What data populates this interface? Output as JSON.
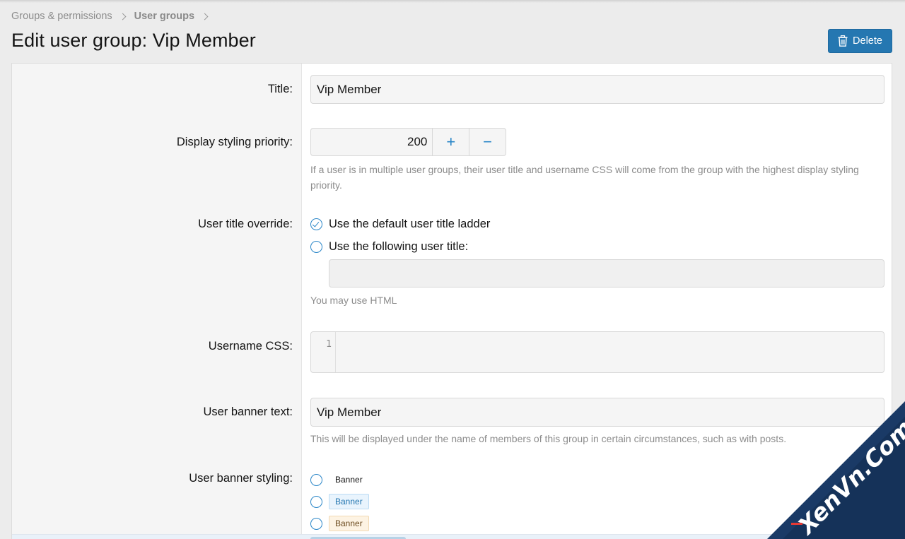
{
  "breadcrumb": {
    "items": [
      "Groups & permissions",
      "User groups"
    ]
  },
  "page": {
    "title": "Edit user group: Vip Member"
  },
  "actions": {
    "delete_label": "Delete"
  },
  "form": {
    "title": {
      "label": "Title:",
      "value": "Vip Member"
    },
    "priority": {
      "label": "Display styling priority:",
      "value": "200",
      "plus": "+",
      "minus": "−",
      "hint": "If a user is in multiple user groups, their user title and username CSS will come from the group with the highest display styling priority."
    },
    "user_title_override": {
      "label": "User title override:",
      "options": [
        "Use the default user title ladder",
        "Use the following user title:"
      ],
      "selected_index": 0,
      "custom_value": "",
      "hint": "You may use HTML"
    },
    "username_css": {
      "label": "Username CSS:",
      "line_number": "1",
      "value": ""
    },
    "banner_text": {
      "label": "User banner text:",
      "value": "Vip Member",
      "hint": "This will be displayed under the name of members of this group in certain circumstances, such as with posts."
    },
    "banner_styling": {
      "label": "User banner styling:",
      "options": [
        "Banner",
        "Banner",
        "Banner"
      ]
    }
  },
  "watermark": {
    "text": "XenVn.Com"
  },
  "colors": {
    "accent": "#2577b1",
    "radio": "#2a86c8",
    "label_col_bg": "#f5f5f5",
    "page_bg": "#ececec"
  }
}
